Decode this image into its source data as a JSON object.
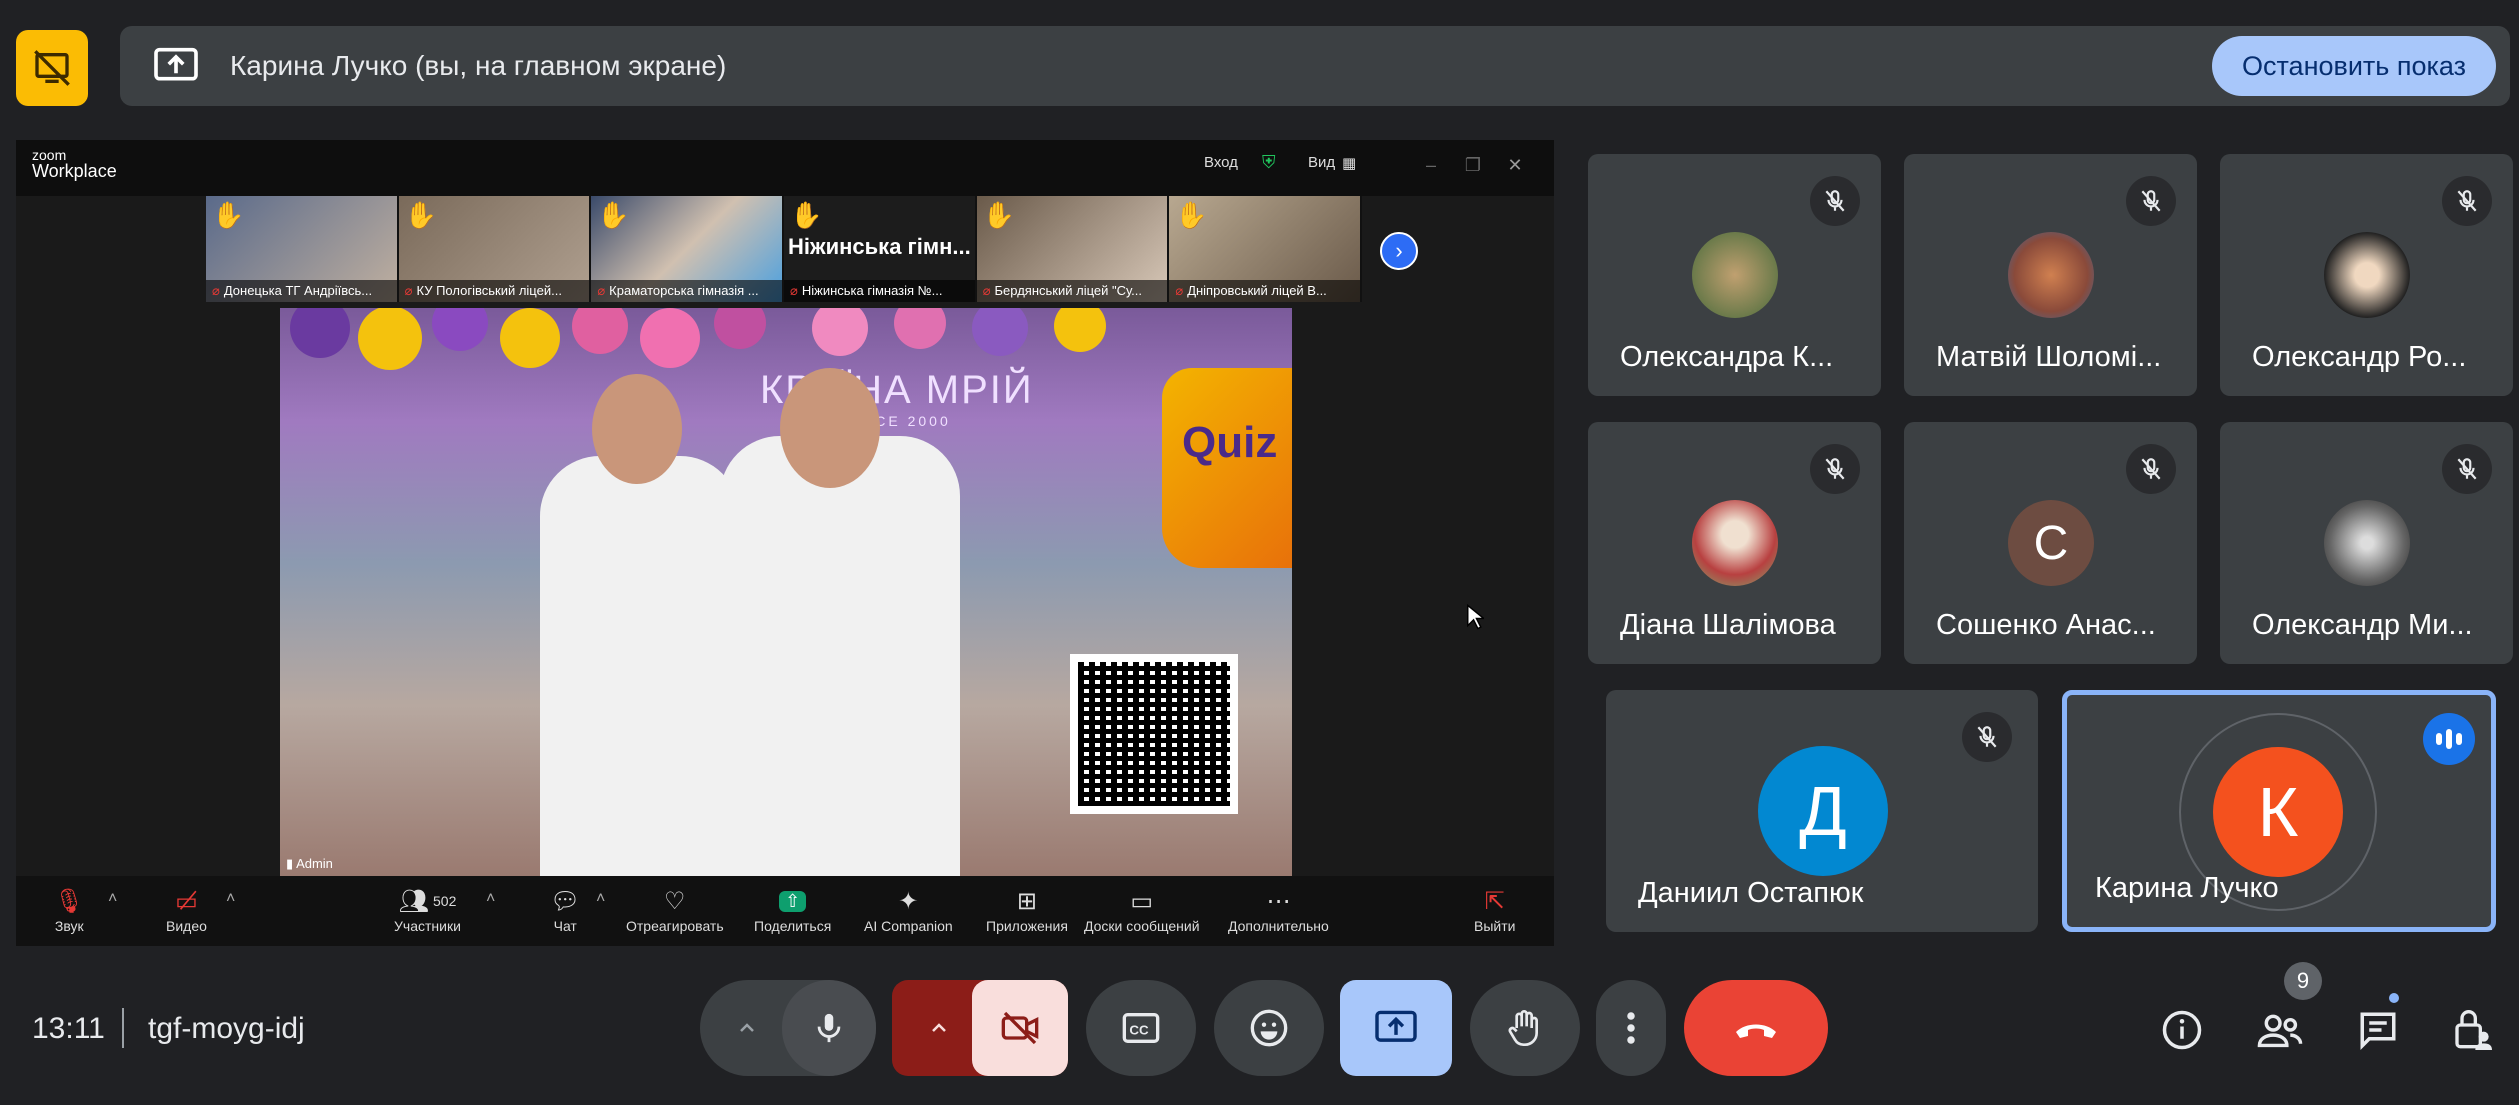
{
  "share_bar": {
    "title": "Карина Лучко (вы, на главном экране)",
    "stop_label": "Остановить показ"
  },
  "zoom": {
    "logo_top": "zoom",
    "logo_bottom": "Workplace",
    "signin": "Вход",
    "view": "Вид",
    "thumbnails": [
      {
        "caption": "Донецька ТГ Андріївсь...",
        "hand": "✋"
      },
      {
        "caption": "КУ Пологівський ліцей...",
        "hand": "✋"
      },
      {
        "caption": "Краматорська гімназія ...",
        "hand": "✋"
      },
      {
        "caption": "Ніжинська гімназія №...",
        "hand": "✋",
        "big": "Ніжинська гімн..."
      },
      {
        "caption": "Бердянський ліцей \"Су...",
        "hand": "✋"
      },
      {
        "caption": "Дніпровський ліцей В...",
        "hand": "✋"
      }
    ],
    "stage": {
      "banner": "КРАЇНА МРІЙ",
      "banner_sub": "SINCE 2000",
      "quiz": "Quiz",
      "admin_label": "Admin"
    },
    "toolbar": {
      "audio": "Звук",
      "video": "Видео",
      "participants": "Участники",
      "participants_count": "502",
      "chat": "Чат",
      "react": "Отреагировать",
      "share": "Поделиться",
      "ai": "AI Companion",
      "apps": "Приложения",
      "whiteboards": "Доски сообщений",
      "more": "Дополнительно",
      "leave": "Выйти"
    }
  },
  "participants": [
    {
      "name": "Олександра К...",
      "avatar_color": "#6b7a4a"
    },
    {
      "name": "Матвій Шоломі...",
      "avatar_color": "#8a4a3a"
    },
    {
      "name": "Олександр Ро...",
      "avatar_color": "#d8d8d8"
    },
    {
      "name": "Діана Шалімова",
      "avatar_color": "#b84040"
    },
    {
      "name": "Сошенко Анас...",
      "initial": "С",
      "avatar_color": "#6d4c41"
    },
    {
      "name": "Олександр Ми...",
      "avatar_color": "#777777"
    },
    {
      "name": "Даниил Остапюк",
      "initial": "Д",
      "avatar_color": "#0288d1"
    },
    {
      "name": "Карина Лучко",
      "initial": "К",
      "avatar_color": "#f4511e"
    }
  ],
  "footer": {
    "time": "13:11",
    "meeting_code": "tgf-moyg-idj",
    "people_count": "9"
  },
  "colors": {
    "accent": "#a8c7fa",
    "end_call": "#ea4335",
    "camera_off_bg": "#f9dedc",
    "camera_caret_bg": "#8c1d18",
    "present_active": "#a8c7fa"
  }
}
